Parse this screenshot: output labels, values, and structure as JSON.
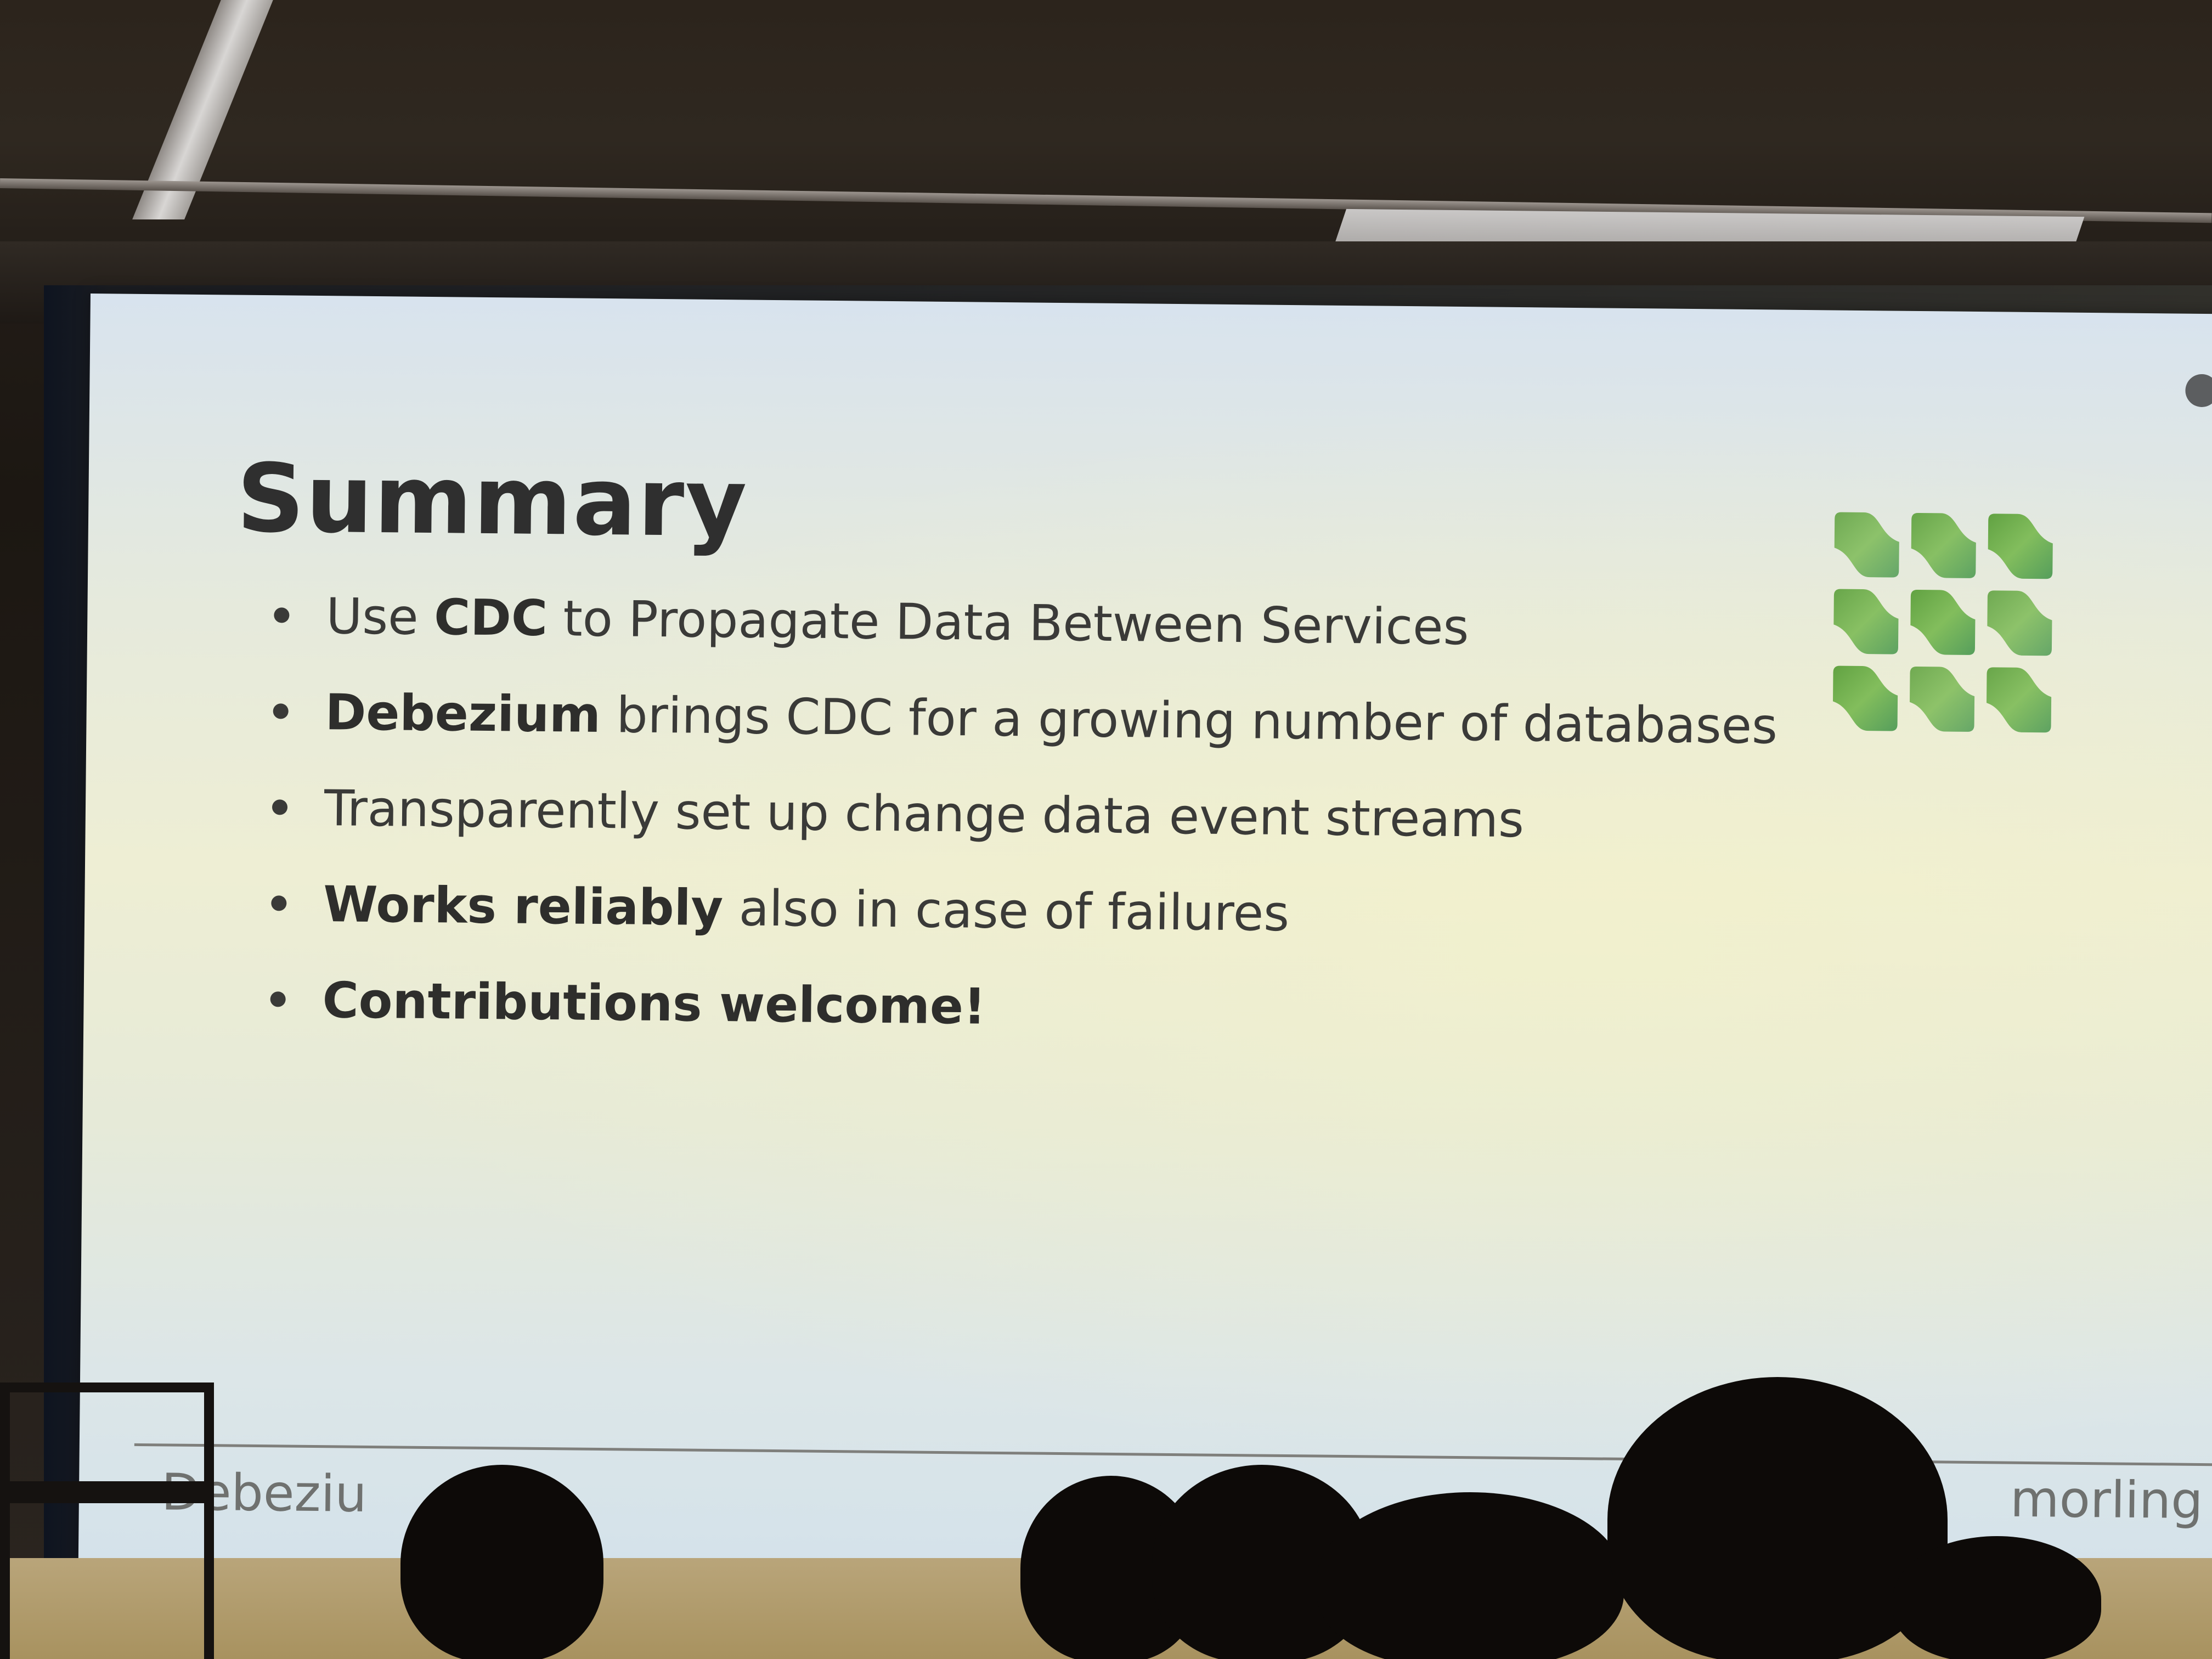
{
  "slide": {
    "title": "Summary",
    "bullets": [
      [
        {
          "text": "Use ",
          "bold": false
        },
        {
          "text": "CDC",
          "bold": true
        },
        {
          "text": " to Propagate Data Between Services",
          "bold": false
        }
      ],
      [
        {
          "text": "Debezium",
          "bold": true
        },
        {
          "text": " brings CDC for a growing number of databases",
          "bold": false
        }
      ],
      [
        {
          "text": "Transparently set up change data event streams",
          "bold": false
        }
      ],
      [
        {
          "text": "Works reliably",
          "bold": true
        },
        {
          "text": " also in case of failures",
          "bold": false
        }
      ],
      [
        {
          "text": "Contributions welcome!",
          "bold": true
        }
      ]
    ],
    "footer_left": "Debeziu",
    "footer_right": "morling"
  },
  "logo": {
    "name": "debezium-logo",
    "colors": [
      "#5a9e3a",
      "#6fae44",
      "#7dbb56",
      "#5aa46a",
      "#4e9a55"
    ]
  }
}
